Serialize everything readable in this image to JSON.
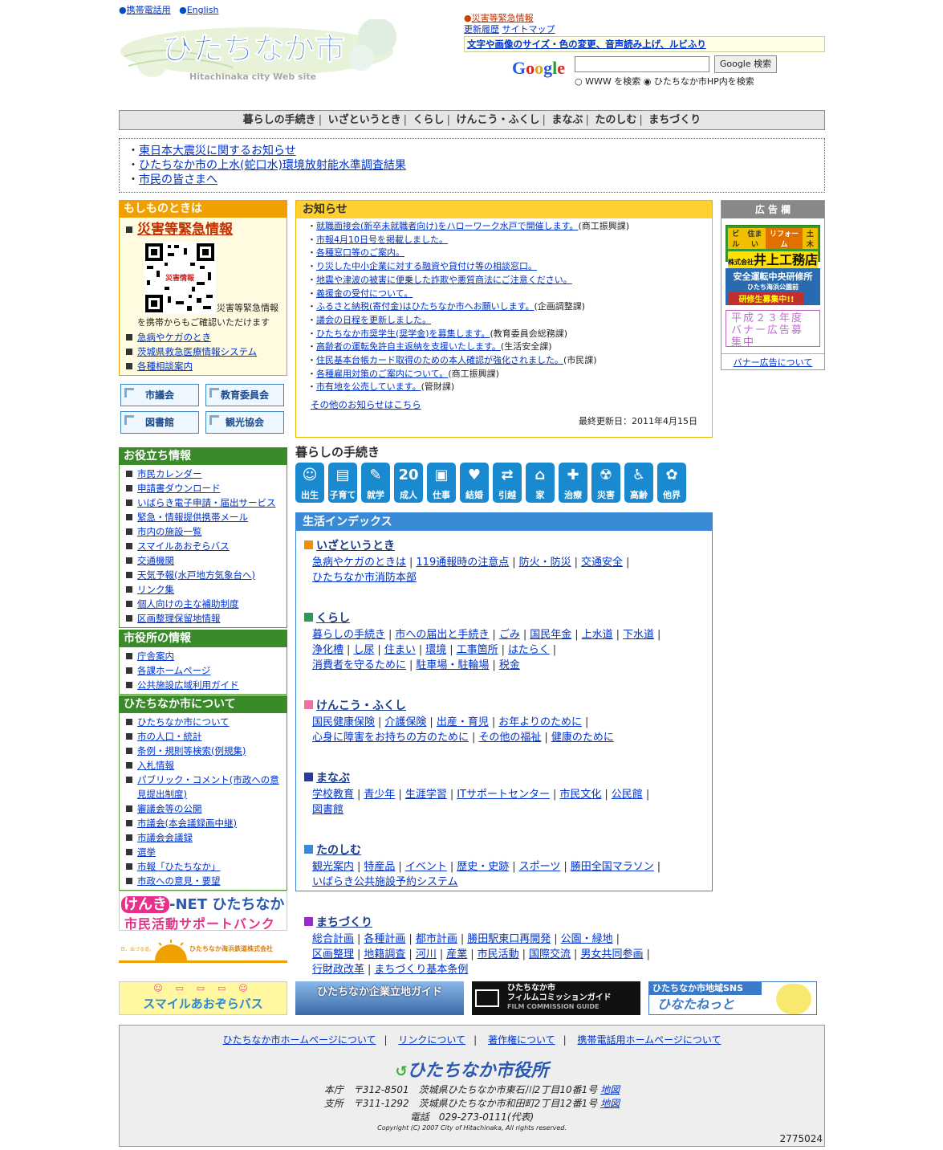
{
  "header": {
    "mobile_link": "携帯電話用",
    "english_link": "English",
    "logo_jp": "ひたちなか市",
    "logo_en": "Hitachinaka city Web site",
    "emergency_link": "災害等緊急情報",
    "history_link": "更新履歴",
    "sitemap_link": "サイトマップ",
    "accessibility_link": "文字や画像のサイズ・色の変更、音声読み上げ、ルビふり",
    "google_logo": "Google",
    "search_button": "Google 検索",
    "radio_www": "WWW を検索",
    "radio_site": "ひたちなか市HP内を検索"
  },
  "gnav": [
    "暮らしの手続き",
    "いざというとき",
    "くらし",
    "けんこう・ふくし",
    "まなぶ",
    "たのしむ",
    "まちづくり"
  ],
  "top_notices": [
    "東日本大震災に関するお知らせ",
    "ひたちなか市の上水(蛇口水)環境放射能水準調査結果",
    "市民の皆さまへ"
  ],
  "mosimo": {
    "title": "もしものときは",
    "emergency": "災害等緊急情報",
    "qr_label": "災害情報",
    "qr_caption": "災害等緊急情報",
    "qr_caption2": "を携帯からもご確認いただけます",
    "links": [
      "急病やケガのとき",
      "茨城県救急医療情報システム",
      "各種相談案内"
    ]
  },
  "side_buttons": [
    "市議会",
    "教育委員会",
    "図書館",
    "観光協会"
  ],
  "useful": {
    "title": "お役立ち情報",
    "links": [
      "市民カレンダー",
      "申請書ダウンロード",
      "いばらき電子申請・届出サービス",
      "緊急・情報提供携帯メール",
      "市内の施設一覧",
      "スマイルあおぞらバス",
      "交通機関",
      "天気予報(水戸地方気象台へ)",
      "リンク集",
      "個人向けの主な補助制度",
      "区画整理保留地情報"
    ]
  },
  "cityhall": {
    "title": "市役所の情報",
    "links": [
      "庁舎案内",
      "各課ホームページ",
      "公共施設広域利用ガイド"
    ]
  },
  "about": {
    "title": "ひたちなか市について",
    "links": [
      "ひたちなか市について",
      "市の人口・統計",
      "条例・規則等検索(例規集)",
      "入札情報",
      "パブリック・コメント(市政への意見提出制度)",
      "審議会等の公開",
      "市議会(本会議録画中継)",
      "市議会会議録",
      "選挙",
      "市報「ひたちなか」",
      "市政への意見・要望"
    ]
  },
  "left_banners": {
    "genki_1": "けんき",
    "genki_2": "-NET ひたちなか",
    "genki_3": "市民活動サポートバンク",
    "rail": "ひたちなか海浜鉄道株式会社",
    "rail_sub": "日、出づる道。"
  },
  "news": {
    "title": "お知らせ",
    "items": [
      {
        "text": "就職面接会(新卒未就職者向け)をハローワーク水戸で開催します。",
        "dept": "(商工振興課)"
      },
      {
        "text": "市報4月10日号を掲載しました。",
        "dept": ""
      },
      {
        "text": "各種窓口等のご案内。",
        "dept": ""
      },
      {
        "text": "り災した中小企業に対する融資や貸付け等の相談窓口。",
        "dept": ""
      },
      {
        "text": "地震や津波の被害に便乗した詐欺や悪質商法にご注意ください。",
        "dept": ""
      },
      {
        "text": "義援金の受付について。",
        "dept": ""
      },
      {
        "text": "ふるさと納税(寄付金)はひたちなか市へお願いします。",
        "dept": "(企画調整課)"
      },
      {
        "text": "議会の日程を更新しました。",
        "dept": ""
      },
      {
        "text": "ひたちなか市奨学生(奨学金)を募集します。",
        "dept": "(教育委員会総務課)"
      },
      {
        "text": "高齢者の運転免許自主返納を支援いたします。",
        "dept": "(生活安全課)"
      },
      {
        "text": "住民基本台帳カード取得のための本人確認が強化されました。",
        "dept": "(市民課)"
      },
      {
        "text": "各種雇用対策のご案内について。",
        "dept": "(商工振興課)"
      },
      {
        "text": "市有地を公売しています。",
        "dept": "(管財課)"
      }
    ],
    "more": "その他のお知らせはこちら",
    "updated": "最終更新日：2011年4月15日"
  },
  "kurashi": {
    "title": "暮らしの手続き",
    "icons": [
      {
        "glyph": "☺",
        "label": "出生"
      },
      {
        "glyph": "▤",
        "label": "子育て"
      },
      {
        "glyph": "✎",
        "label": "就学"
      },
      {
        "glyph": "20",
        "label": "成人"
      },
      {
        "glyph": "▣",
        "label": "仕事"
      },
      {
        "glyph": "♥",
        "label": "結婚"
      },
      {
        "glyph": "⇄",
        "label": "引越"
      },
      {
        "glyph": "⌂",
        "label": "家"
      },
      {
        "glyph": "✚",
        "label": "治療"
      },
      {
        "glyph": "☢",
        "label": "災害"
      },
      {
        "glyph": "♿",
        "label": "高齢"
      },
      {
        "glyph": "✿",
        "label": "他界"
      }
    ]
  },
  "life_index": {
    "title": "生活インデックス",
    "cats": [
      {
        "name": "いざというとき",
        "color": "#f09000",
        "rows": [
          [
            "急病やケガのときは",
            "119通報時の注意点",
            "防火・防災",
            "交通安全"
          ],
          [
            "ひたちなか市消防本部"
          ]
        ]
      },
      {
        "name": "くらし",
        "color": "#2a9a5a",
        "rows": [
          [
            "暮らしの手続き",
            "市への届出と手続き",
            "ごみ",
            "国民年金",
            "上水道",
            "下水道"
          ],
          [
            "浄化槽",
            "し尿",
            "住まい",
            "環境",
            "工事箇所",
            "はたらく"
          ],
          [
            "消費者を守るために",
            "駐車場・駐輪場",
            "税金"
          ]
        ]
      },
      {
        "name": "けんこう・ふくし",
        "color": "#f070a0",
        "rows": [
          [
            "国民健康保険",
            "介護保険",
            "出産・育児",
            "お年よりのために"
          ],
          [
            "心身に障害をお持ちの方のために",
            "その他の福祉",
            "健康のために"
          ]
        ]
      },
      {
        "name": "まなぶ",
        "color": "#2a3a9a",
        "rows": [
          [
            "学校教育",
            "青少年",
            "生涯学習",
            "ITサポートセンター",
            "市民文化",
            "公民館"
          ],
          [
            "図書館"
          ]
        ]
      },
      {
        "name": "たのしむ",
        "color": "#3a8ad8",
        "rows": [
          [
            "観光案内",
            "特産品",
            "イベント",
            "歴史・史跡",
            "スポーツ",
            "勝田全国マラソン"
          ],
          [
            "いばらき公共施設予約システム"
          ]
        ]
      },
      {
        "name": "まちづくり",
        "color": "#9a2ad0",
        "rows": [
          [
            "総合計画",
            "各種計画",
            "都市計画",
            "勝田駅東口再開発",
            "公園・緑地"
          ],
          [
            "区画整理",
            "地籍調査",
            "河川",
            "産業",
            "市民活動",
            "国際交流",
            "男女共同参画"
          ],
          [
            "行財政改革",
            "まちづくり基本条例"
          ]
        ]
      }
    ]
  },
  "ads": {
    "title": "広 告 欄",
    "ad1_tags": [
      "ビル",
      "住まい",
      "リフォーム",
      "土木"
    ],
    "ad1_name": "井上工務店",
    "ad1_kk": "株式会社",
    "ad2_l1": "安全運転中央研修所",
    "ad2_l2": "ひたち海浜公園前",
    "ad2_l3": "研修生募集中!!",
    "ad3": "平成２３年度バナー広告募集中",
    "about": "バナー広告について"
  },
  "bottom_banners": {
    "bus": "スマイルあおぞらバス",
    "biz": "ひたちなか企業立地ガイド",
    "film_1": "ひたちなか市",
    "film_2": "フィルムコミッションガイド",
    "film_3": "FILM COMMISSION GUIDE",
    "sns_1": "ひたちなか市地域SNS",
    "sns_2": "ひなたねっと"
  },
  "footer": {
    "links": [
      "ひたちなか市ホームページについて",
      "リンクについて",
      "著作権について",
      "携帯電話用ホームページについて"
    ],
    "name": "ひたちなか市役所",
    "addr1": "本庁　〒312-8501　茨城県ひたちなか市東石川2丁目10番1号",
    "addr2": "支所　〒311-1292　茨城県ひたちなか市和田町2丁目12番1号",
    "map": "地図",
    "tel": "電話　029-273-0111(代表)",
    "copyright": "Copyright (C) 2007 City of Hitachinaka, All rights reserved.",
    "counter": "2775024"
  },
  "colors": {
    "link": "#0033cc",
    "green": "#3a8a2a",
    "orange": "#f0a000",
    "blue": "#3a8ad8"
  }
}
